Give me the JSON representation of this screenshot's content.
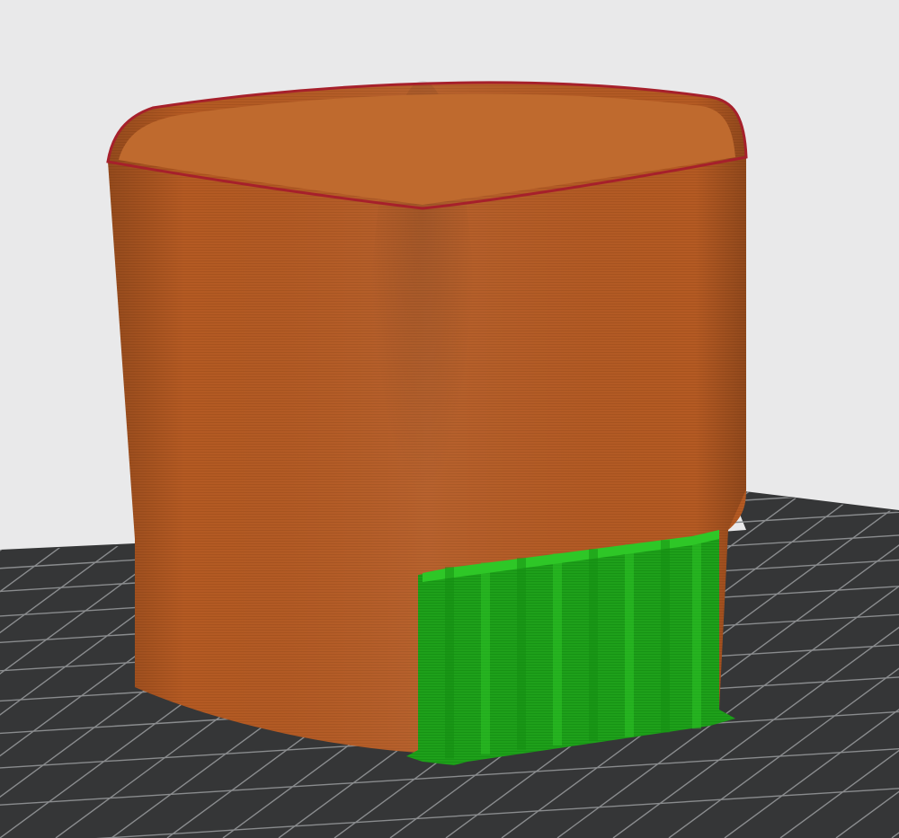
{
  "viewport": {
    "background_color": "#e9e9ea",
    "camera_mode": "perspective"
  },
  "build_plate": {
    "plate_color": "#353637",
    "grid_line_color": "#8a8c8e"
  },
  "objects": [
    {
      "name": "vase-model",
      "shape": "rounded-square-vase",
      "layer_color": "#b45a23",
      "rim_color": "#a6202b",
      "interior_color": "#bf6a2e"
    },
    {
      "name": "support-structure",
      "shape": "support-block",
      "color": "#1ea01a",
      "highlight_color": "#2ec727"
    }
  ]
}
